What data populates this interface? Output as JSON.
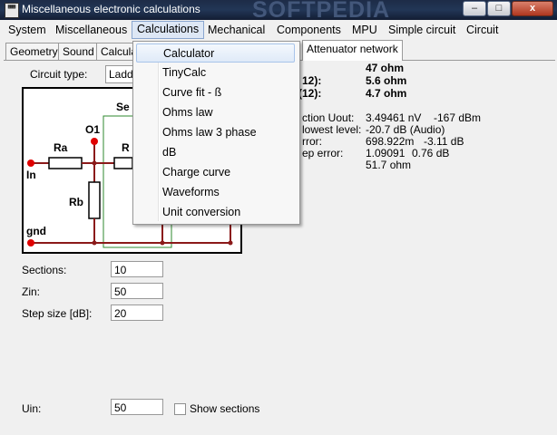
{
  "window": {
    "title": "Miscellaneous electronic calculations",
    "watermark": "SOFTPEDIA",
    "minimize_glyph": "–",
    "maximize_glyph": "□",
    "close_glyph": "x"
  },
  "menubar": {
    "items": [
      "System",
      "Miscellaneous",
      "Calculations",
      "Mechanical",
      "Components",
      "MPU",
      "Simple circuit",
      "Circuit"
    ]
  },
  "tabs": [
    "Geometry",
    "Sound",
    "Calcula",
    "Attenuator network"
  ],
  "calculations_menu": {
    "items": [
      "Calculator",
      "TinyCalc",
      "Curve fit - ß",
      "Ohms law",
      "Ohms law 3 phase",
      "dB",
      "Charge curve",
      "Waveforms",
      "Unit conversion"
    ]
  },
  "form": {
    "circuit_type_label": "Circuit type:",
    "circuit_type_value": "Ladd",
    "sections_label": "Sections:",
    "sections_value": "10",
    "zin_label": "Zin:",
    "zin_value": "50",
    "step_label": "Step size [dB]:",
    "step_value": "20",
    "uin_label": "Uin:",
    "uin_value": "50",
    "show_sections_label": "Show sections"
  },
  "circuit": {
    "in": "In",
    "gnd": "gnd",
    "o1": "O1",
    "ra": "Ra",
    "rb": "Rb",
    "r_partial": "R",
    "se_partial": "Se"
  },
  "results": {
    "rows_bold": [
      {
        "label": "",
        "value": "47 ohm"
      },
      {
        "label": "12):",
        "value": "5.6 ohm"
      },
      {
        "label": "(12):",
        "value": "4.7 ohm"
      }
    ],
    "rows": [
      {
        "label": "ction Uout:",
        "v1": "3.49461 nV",
        "v2": "-167 dBm"
      },
      {
        "label": "lowest level:",
        "v1": "-20.7 dB (Audio)",
        "v2": ""
      },
      {
        "label": "rror:",
        "v1": "698.922m",
        "v2": "-3.11 dB"
      },
      {
        "label": "ep error:",
        "v1": "1.09091",
        "v2": "0.76 dB"
      },
      {
        "label": "",
        "v1": "51.7 ohm",
        "v2": ""
      }
    ]
  }
}
